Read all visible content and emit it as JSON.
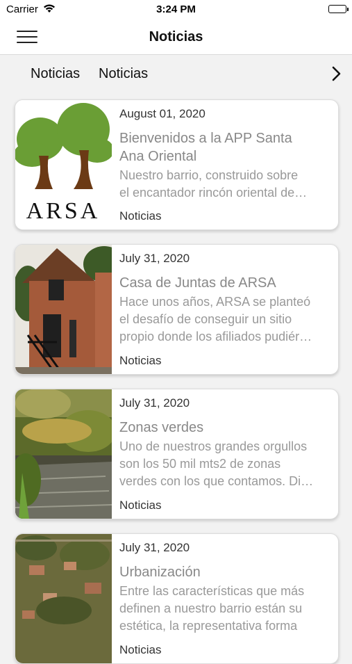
{
  "status_bar": {
    "carrier": "Carrier",
    "time": "3:24 PM"
  },
  "nav": {
    "title": "Noticias"
  },
  "tabs": [
    {
      "label": "Noticias"
    },
    {
      "label": "Noticias"
    }
  ],
  "icons": {
    "menu": "menu-icon",
    "next": "chevron-right-icon",
    "wifi": "wifi-icon",
    "battery": "battery-icon"
  },
  "articles": [
    {
      "date": "August 01, 2020",
      "title_line1": "Bienvenidos a la APP Santa",
      "title_line2": "Ana Oriental",
      "excerpt_line1": "Nuestro barrio, construido sobre",
      "excerpt_line2": "el encantador rincón oriental de…",
      "category": "Noticias",
      "logo_text": "ARSA"
    },
    {
      "date": "July 31, 2020",
      "title_line1": "Casa de Juntas de ARSA",
      "excerpt_line1": "Hace unos años, ARSA se planteó",
      "excerpt_line2": "el desafío de conseguir un sitio",
      "excerpt_line3": "propio donde los afiliados pudiér…",
      "category": "Noticias"
    },
    {
      "date": "July 31, 2020",
      "title_line1": "Zonas verdes",
      "excerpt_line1": "Uno de nuestros grandes orgullos",
      "excerpt_line2": "son los 50 mil mts2 de zonas",
      "excerpt_line3": "verdes con los que contamos. Di…",
      "category": "Noticias"
    },
    {
      "date": "July 31, 2020",
      "title_line1": "Urbanización",
      "excerpt_line1": "Entre las características que más",
      "excerpt_line2": "definen a nuestro barrio están su",
      "excerpt_line3": "estética, la representativa forma",
      "category": "Noticias"
    }
  ]
}
